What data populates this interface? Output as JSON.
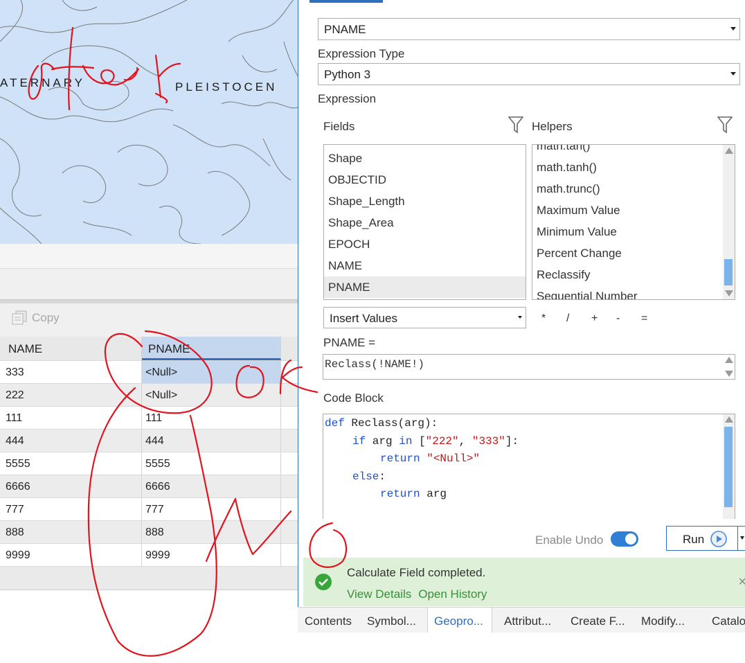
{
  "map": {
    "label_left": "ATERNARY",
    "label_right": "PLEISTOCEN"
  },
  "table": {
    "toolbar": {
      "copy_label": "Copy",
      "copy_icon": "copy-icon"
    },
    "columns": [
      "NAME",
      "PNAME"
    ],
    "rows": [
      {
        "name": "333",
        "pname": "<Null>"
      },
      {
        "name": "222",
        "pname": "<Null>"
      },
      {
        "name": "111",
        "pname": "111"
      },
      {
        "name": "444",
        "pname": "444"
      },
      {
        "name": "5555",
        "pname": "5555"
      },
      {
        "name": "6666",
        "pname": "6666"
      },
      {
        "name": "777",
        "pname": "777"
      },
      {
        "name": "888",
        "pname": "888"
      },
      {
        "name": "9999",
        "pname": "9999"
      }
    ]
  },
  "pane": {
    "field_value": "PNAME",
    "expression_type_label": "Expression Type",
    "expression_type_value": "Python 3",
    "expression_label": "Expression",
    "fields_label": "Fields",
    "helpers_label": "Helpers",
    "fields": [
      "Shape",
      "OBJECTID",
      "Shape_Length",
      "Shape_Area",
      "EPOCH",
      "NAME",
      "PNAME"
    ],
    "helpers": [
      "math.tan()",
      "math.tanh()",
      "math.trunc()",
      "Maximum Value",
      "Minimum Value",
      "Percent Change",
      "Reclassify",
      "Sequential Number"
    ],
    "insert_values": "Insert Values",
    "operators": [
      "*",
      "/",
      "+",
      "-",
      "="
    ],
    "expr_label": "PNAME =",
    "expression": "Reclass(!NAME!)",
    "code_block_label": "Code Block",
    "code": {
      "l1_kw": "def",
      "l1_rest": " Reclass(arg):",
      "l2_kw1": "if",
      "l2_mid": " arg ",
      "l2_kw2": "in",
      "l2_open": " [",
      "l2_s1": "\"222\"",
      "l2_comma": ", ",
      "l2_s2": "\"333\"",
      "l2_close": "]:",
      "l3_kw": "return",
      "l3_str": "\"<Null>\"",
      "l4_kw": "else",
      "l4_rest": ":",
      "l5_kw": "return",
      "l5_rest": " arg"
    },
    "enable_undo_label": "Enable Undo",
    "enable_undo_on": true,
    "run_label": "Run",
    "message": {
      "title": "Calculate Field completed.",
      "view_details": "View Details",
      "open_history": "Open History",
      "close": "×"
    },
    "bottom_tabs": [
      {
        "label": "Contents",
        "active": false
      },
      {
        "label": "Symbol...",
        "active": false
      },
      {
        "label": "Geopro...",
        "active": true
      },
      {
        "label": "Attribut...",
        "active": false
      },
      {
        "label": "Create F...",
        "active": false
      },
      {
        "label": "Modify...",
        "active": false
      },
      {
        "label": "Catalo",
        "active": false
      }
    ]
  },
  "colors": {
    "accent": "#2f6fbd",
    "map_fill": "#cfe2f8",
    "success_bg": "#dff0d8",
    "annotation": "#e0141e"
  }
}
